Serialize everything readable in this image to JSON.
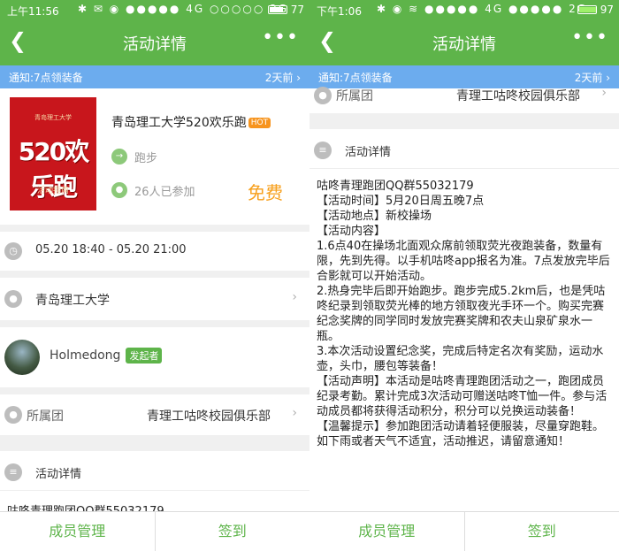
{
  "left": {
    "status": {
      "time": "上午11:56",
      "signal": "✱ ✉ ◉ ●●●●● 4G ○○○○○ 2G",
      "battery": "77"
    },
    "nav": {
      "title": "活动详情"
    },
    "notice": {
      "text": "通知:7点领装备",
      "right": "2天前"
    },
    "activity": {
      "poster": {
        "top": "青岛理工大学",
        "main": "520欢乐跑",
        "bottom": "活动指南"
      },
      "name": "青岛理工大学520欢乐跑",
      "hot": "HOT",
      "type": "跑步",
      "participants": "26人已参加",
      "price": "免费"
    },
    "time_range": "05.20 18:40 - 05.20 21:00",
    "location": "青岛理工大学",
    "organizer": {
      "name": "Holmedong",
      "badge": "发起者"
    },
    "club": {
      "label": "所属团",
      "value": "青理工咕咚校园俱乐部"
    },
    "details_header": "活动详情",
    "first_line": "咕咚青理跑团QQ群55032179"
  },
  "right": {
    "status": {
      "time": "下午1:06",
      "signal": "✱ ◉ ≋ ●●●●● 4G ●●●●● 2G",
      "battery": "97"
    },
    "nav": {
      "title": "活动详情"
    },
    "notice": {
      "text": "通知:7点领装备",
      "right": "2天前"
    },
    "club": {
      "label": "所属团",
      "value": "青理工咕咚校园俱乐部"
    },
    "details_header": "活动详情",
    "details": [
      "咕咚青理跑团QQ群55032179",
      "【活动时间】5月20日周五晚7点",
      "【活动地点】新校操场",
      "【活动内容】",
      "1.6点40在操场北面观众席前领取荧光夜跑装备，数量有限，先到先得。以手机咕咚app报名为准。7点发放完毕后合影就可以开始活动。",
      "2.热身完毕后即开始跑步。跑步完成5.2km后，也是凭咕咚纪录到领取荧光棒的地方领取夜光手环一个。购买完赛纪念奖牌的同学同时发放完赛奖牌和农夫山泉矿泉水一瓶。",
      "3.本次活动设置纪念奖，完成后特定名次有奖励，运动水壶，头巾，腰包等装备！",
      "【活动声明】本活动是咕咚青理跑团活动之一，跑团成员纪录考勤。累计完成3次活动可赠送咕咚T恤一件。参与活动成员都将获得活动积分，积分可以兑换运动装备！",
      "【温馨提示】参加跑团活动请着轻便服装，尽量穿跑鞋。如下雨或者天气不适宜，活动推迟，请留意通知！"
    ]
  },
  "bottom": {
    "members": "成员管理",
    "checkin": "签到"
  },
  "icons": {
    "back": "chevron-left-icon",
    "more": "more-dots-icon",
    "chevron": "chevron-right-icon",
    "clock": "clock-icon",
    "pin": "location-pin-icon",
    "person": "person-icon",
    "run": "running-icon",
    "doc": "document-icon",
    "group": "group-icon"
  },
  "colors": {
    "primary": "#5eb44a",
    "notice": "#6cacee",
    "price": "#f7a01d",
    "hot": "#f7941d"
  }
}
